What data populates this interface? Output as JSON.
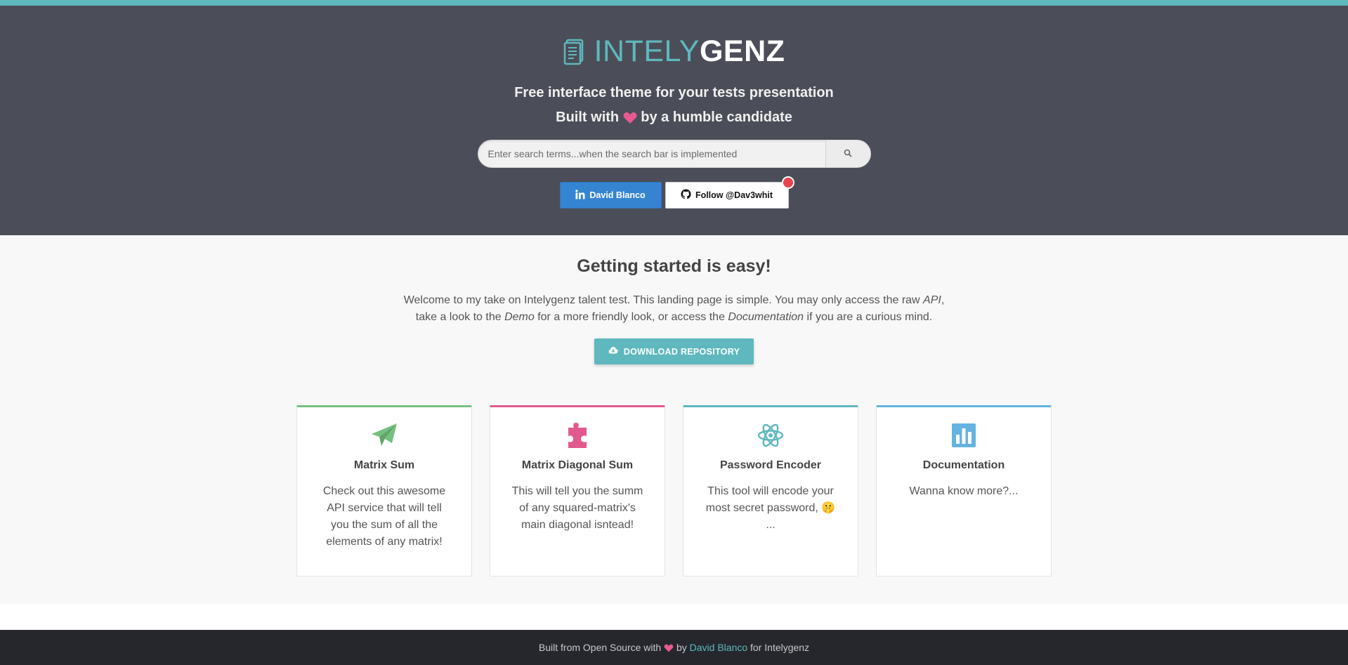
{
  "brand": {
    "part_a": "INTELY",
    "part_b": "GENZ",
    "icon": "document-icon"
  },
  "hero": {
    "tagline": "Free interface theme for your tests presentation",
    "built_prefix": "Built with",
    "built_suffix": "by a humble candidate"
  },
  "search": {
    "placeholder": "Enter search terms...when the search bar is implemented",
    "value": ""
  },
  "social": {
    "linkedin_label": "David Blanco",
    "github_label": "Follow @Dav3whit"
  },
  "main": {
    "title": "Getting started is easy!",
    "intro_1": "Welcome to my take on Intelygenz talent test. This landing page is simple. You may only access the raw ",
    "intro_api": "API",
    "intro_2": ", take a look to the ",
    "intro_demo": "Demo",
    "intro_3": " for a more friendly look, or access the ",
    "intro_doc": "Documentation",
    "intro_4": " if you are a curious mind.",
    "download_label": "DOWNLOAD REPOSITORY"
  },
  "cards": [
    {
      "title": "Matrix Sum",
      "text": "Check out this awesome API service that will tell you the sum of all the elements of any matrix!",
      "icon": "paper-plane-icon",
      "color": "#74c07f"
    },
    {
      "title": "Matrix Diagonal Sum",
      "text": "This will tell you the summ of any squared-matrix's main diagonal isntead!",
      "icon": "puzzle-icon",
      "color": "#e2598f"
    },
    {
      "title": "Password Encoder",
      "text": "This tool will encode your most secret password, 🤫 ...",
      "icon": "atom-icon",
      "color": "#5eb8bd"
    },
    {
      "title": "Documentation",
      "text": "Wanna know more?...",
      "icon": "bar-chart-icon",
      "color": "#64b3e0"
    }
  ],
  "footer": {
    "prefix": "Built from Open Source with",
    "by": "by",
    "author": "David Blanco",
    "suffix": "for Intelygenz"
  },
  "colors": {
    "accent": "#5eb8bd",
    "hero_bg": "#4b4e58",
    "heart": "#e85a8f",
    "linkedin": "#3584d1",
    "footer_bg": "#25272c"
  }
}
